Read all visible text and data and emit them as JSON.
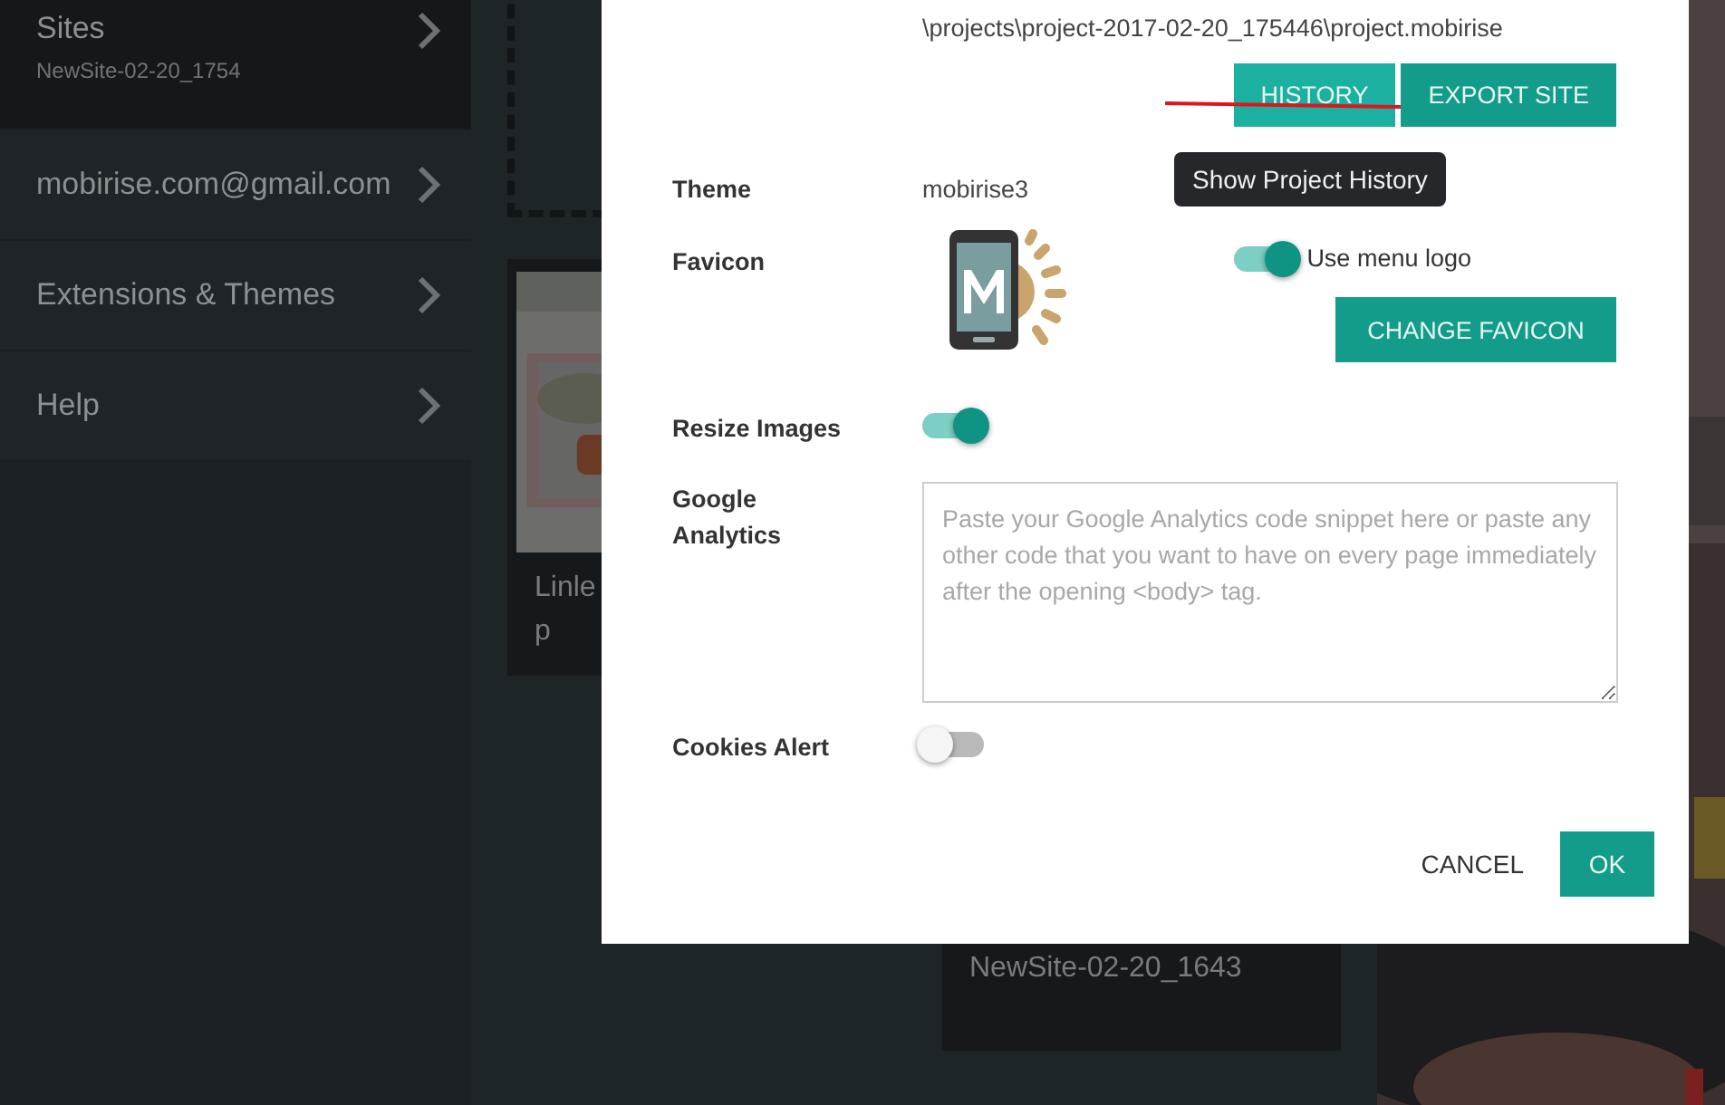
{
  "sidebar": {
    "items": [
      {
        "label": "Sites",
        "sublabel": "NewSite-02-20_1754",
        "selected": true
      },
      {
        "label": "mobirise.com@gmail.com",
        "selected": false
      },
      {
        "label": "Extensions & Themes",
        "selected": false
      },
      {
        "label": "Help",
        "selected": false
      }
    ]
  },
  "cards": [
    {
      "title_lines": [
        "Linle",
        "p"
      ]
    },
    {
      "title_lines": [
        "NewSite-02-20_1643"
      ]
    }
  ],
  "dialog": {
    "path": "\\projects\\project-2017-02-20_175446\\project.mobirise",
    "buttons": [
      {
        "label": "HISTORY",
        "hover": true
      },
      {
        "label": "EXPORT SITE",
        "hover": false
      }
    ],
    "tooltip": "Show Project History",
    "fields": [
      {
        "kind": "text",
        "label": "Theme",
        "value": "mobirise3"
      },
      {
        "kind": "favicon",
        "label": "Favicon",
        "toggle_label": "Use menu logo",
        "on": true,
        "button": "CHANGE FAVICON"
      },
      {
        "kind": "toggle",
        "label": "Resize Images",
        "on": true
      },
      {
        "kind": "textarea",
        "label": "Google Analytics",
        "placeholder": "Paste your Google Analytics code snippet here or paste any other code that you want to have on every page immediately after the opening <body> tag."
      },
      {
        "kind": "toggle",
        "label": "Cookies Alert",
        "on": false
      }
    ],
    "footer": {
      "cancel": "CANCEL",
      "ok": "OK"
    }
  }
}
